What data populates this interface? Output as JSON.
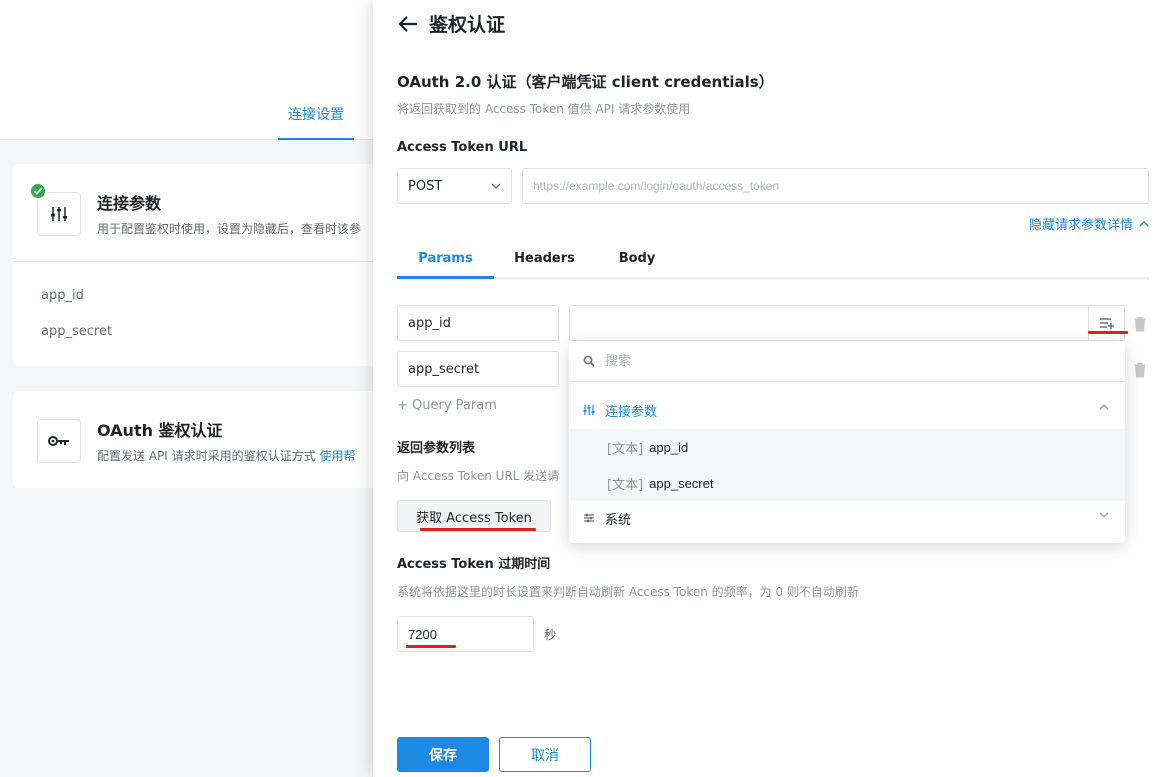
{
  "background": {
    "tab_label": "连接设置",
    "card1": {
      "title": "连接参数",
      "desc": "用于配置鉴权时使用，设置为隐藏后，查看时该参",
      "params": [
        "app_id",
        "app_secret"
      ]
    },
    "card2": {
      "title": "OAuth 鉴权认证",
      "desc": "配置发送 API 请求时采用的鉴权认证方式 ",
      "help_link": "使用帮"
    }
  },
  "drawer": {
    "title": "鉴权认证",
    "section_title": "OAuth 2.0 认证（客户端凭证 client credentials）",
    "section_desc": "将返回获取到的 Access Token 值供 API 请求参数使用",
    "url_label": "Access Token URL",
    "method": "POST",
    "url_placeholder": "https://example.com/login/oauth/access_token",
    "hide_link": "隐藏请求参数详情",
    "tabs": [
      "Params",
      "Headers",
      "Body"
    ],
    "params": [
      {
        "key": "app_id",
        "value": ""
      },
      {
        "key": "app_secret",
        "value": ""
      }
    ],
    "add_param": "+ Query Param",
    "return_title": "返回参数列表",
    "return_desc": "向 Access Token URL 发送请",
    "fetch_button": "获取 Access Token",
    "expire_title": "Access Token 过期时间",
    "expire_desc": "系统将依据这里的时长设置来判断自动刷新 Access Token 的频率，为 0 则不自动刷新",
    "expire_value": "7200",
    "expire_unit": "秒",
    "save_button": "保存",
    "cancel_button": "取消"
  },
  "popover": {
    "search_placeholder": "搜索",
    "groups": [
      {
        "name": "连接参数",
        "expanded": true,
        "options": [
          {
            "type": "[文本]",
            "name": "app_id"
          },
          {
            "type": "[文本]",
            "name": "app_secret"
          }
        ]
      },
      {
        "name": "系统",
        "expanded": false
      }
    ]
  },
  "colors": {
    "accent": "#1e88e5",
    "annotation": "#e0201f",
    "success": "#34a853"
  }
}
